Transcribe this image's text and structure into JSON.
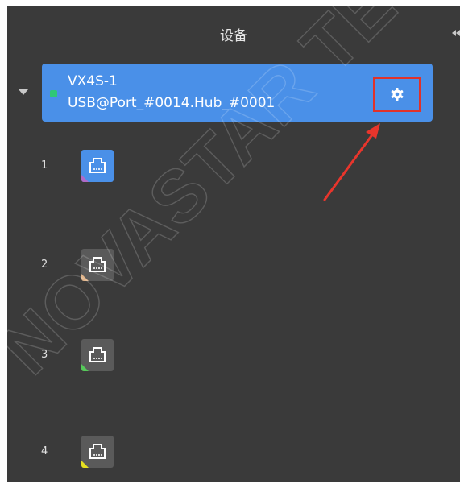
{
  "panel": {
    "title": "设备"
  },
  "device": {
    "name": "VX4S-1",
    "port": "USB@Port_#0014.Hub_#0001",
    "status_color": "#2fc878",
    "accent_color": "#4a90e8",
    "highlight_color": "#e0322a",
    "settings_icon": "gear-icon"
  },
  "ports": [
    {
      "number": "1",
      "icon": "ethernet-port-icon",
      "active": true,
      "corner_color": "#b06ac8"
    },
    {
      "number": "2",
      "icon": "ethernet-port-icon",
      "active": false,
      "corner_color": "#e0b48a"
    },
    {
      "number": "3",
      "icon": "ethernet-port-icon",
      "active": false,
      "corner_color": "#56c85a"
    },
    {
      "number": "4",
      "icon": "ethernet-port-icon",
      "active": false,
      "corner_color": "#e6e020"
    }
  ],
  "watermark": "NOVASTAR TECH"
}
